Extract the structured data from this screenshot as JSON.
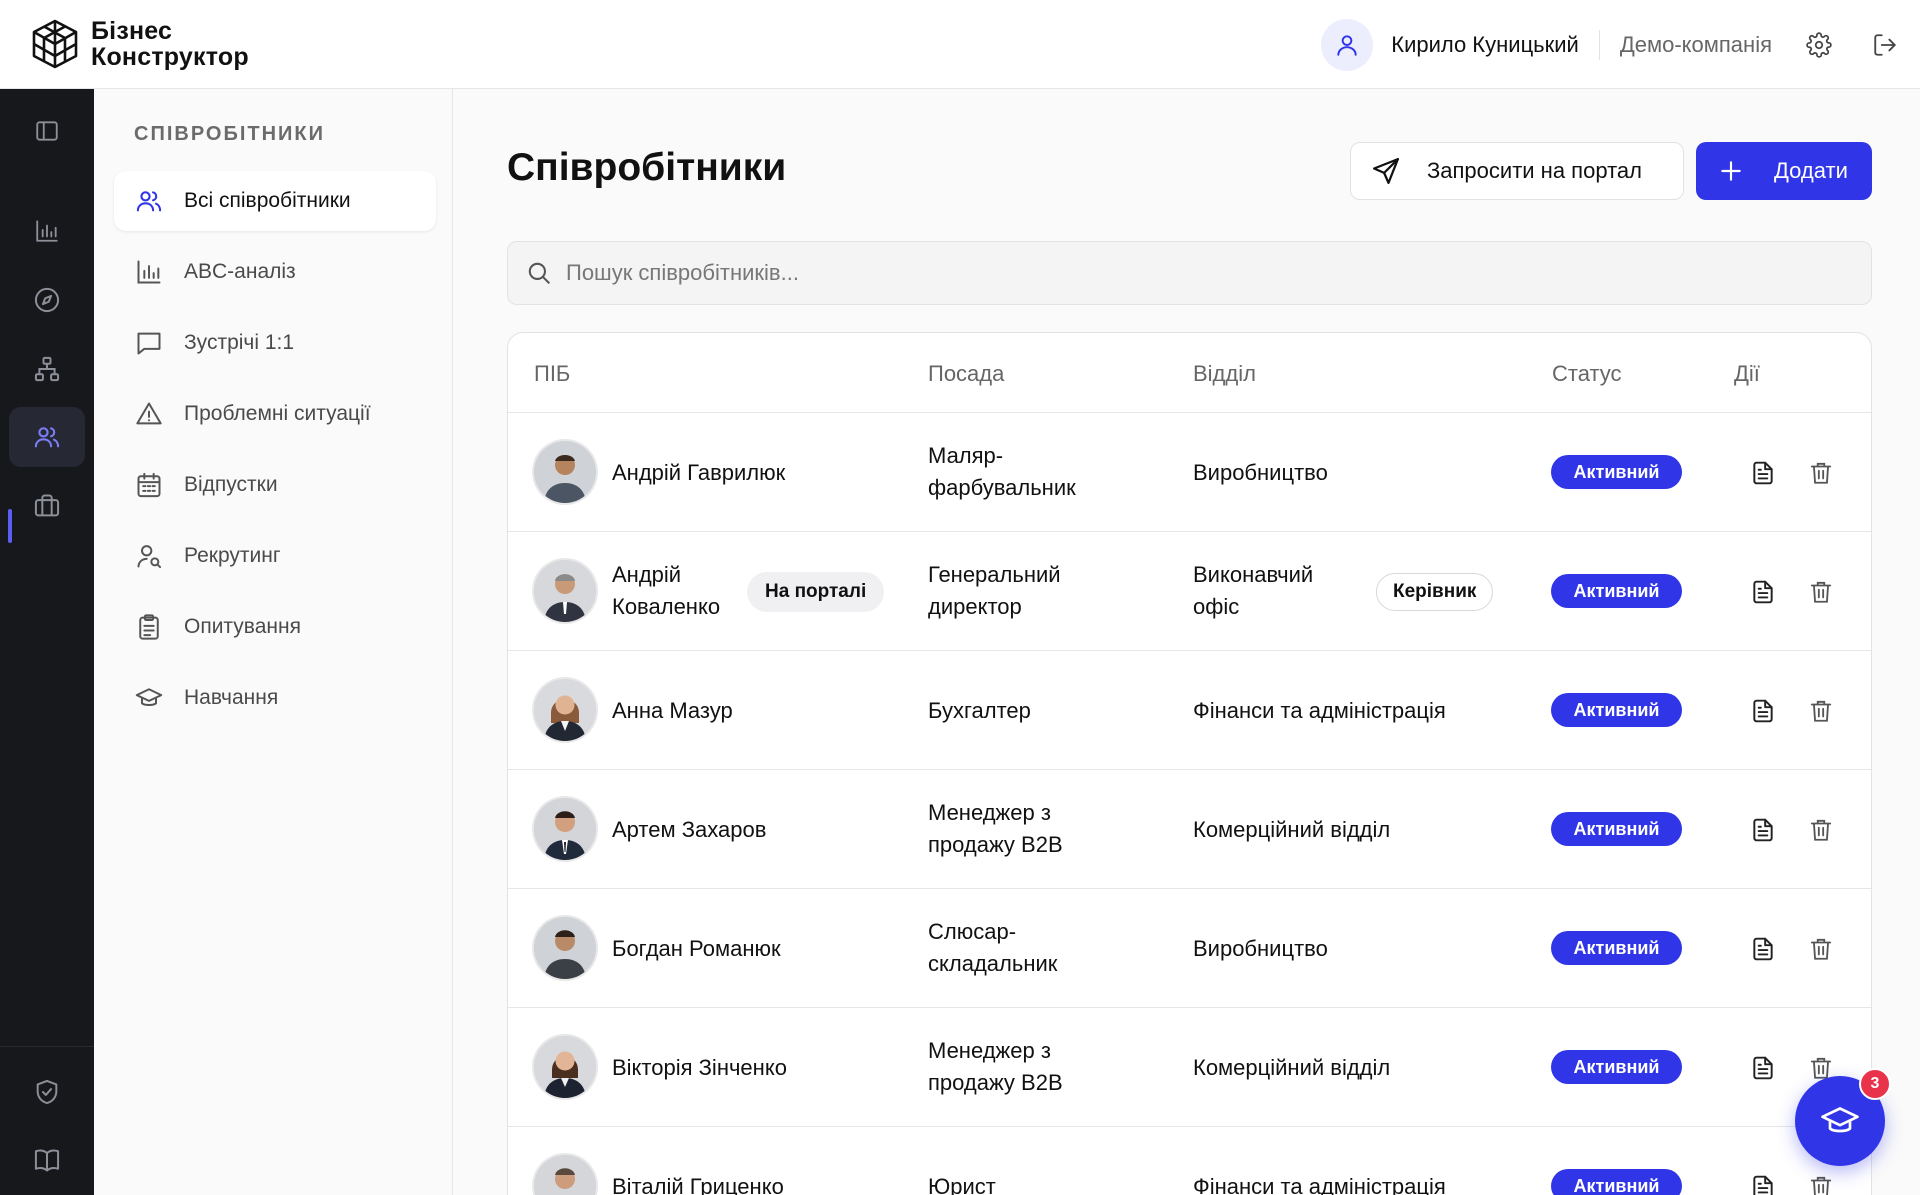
{
  "header": {
    "brand_line1": "Бізнес",
    "brand_line2": "Конструктор",
    "user_name": "Кирило Куницький",
    "company": "Демо-компанія"
  },
  "rail": {
    "icons": [
      "sidebar-toggle-icon",
      "bar-chart-icon",
      "compass-icon",
      "org-structure-icon",
      "users-icon",
      "briefcase-icon",
      "shield-check-icon",
      "book-icon"
    ],
    "active": "users-icon"
  },
  "subnav": {
    "title": "СПІВРОБІТНИКИ",
    "items": [
      {
        "label": "Всі співробітники",
        "icon": "users-icon"
      },
      {
        "label": "ABC-аналіз",
        "icon": "bar-chart-icon"
      },
      {
        "label": "Зустрічі 1:1",
        "icon": "message-icon"
      },
      {
        "label": "Проблемні ситуації",
        "icon": "warning-icon"
      },
      {
        "label": "Відпустки",
        "icon": "calendar-icon"
      },
      {
        "label": "Рекрутинг",
        "icon": "user-search-icon"
      },
      {
        "label": "Опитування",
        "icon": "clipboard-icon"
      },
      {
        "label": "Навчання",
        "icon": "graduation-cap-icon"
      }
    ]
  },
  "main": {
    "title": "Співробітники",
    "invite_label": "Запросити на портал",
    "add_label": "Додати",
    "search_placeholder": "Пошук співробітників..."
  },
  "table": {
    "columns": [
      "ПІБ",
      "Посада",
      "Відділ",
      "Статус",
      "Дії"
    ],
    "rows": [
      {
        "name": [
          "Андрій Гаврилюк"
        ],
        "position": [
          "Маляр-",
          "фарбувальник"
        ],
        "dept": [
          "Виробництво"
        ],
        "status": "Активний"
      },
      {
        "name": [
          "Андрій",
          "Коваленко"
        ],
        "name_tag": "На порталі",
        "position": [
          "Генеральний",
          "директор"
        ],
        "dept": [
          "Виконавчий",
          "офіс"
        ],
        "dept_tag": "Керівник",
        "status": "Активний"
      },
      {
        "name": [
          "Анна Мазур"
        ],
        "position": [
          "Бухгалтер"
        ],
        "dept": [
          "Фінанси та адміністрація"
        ],
        "status": "Активний"
      },
      {
        "name": [
          "Артем Захаров"
        ],
        "position": [
          "Менеджер з",
          "продажу B2B"
        ],
        "dept": [
          "Комерційний відділ"
        ],
        "status": "Активний"
      },
      {
        "name": [
          "Богдан Романюк"
        ],
        "position": [
          "Слюсар-",
          "складальник"
        ],
        "dept": [
          "Виробництво"
        ],
        "status": "Активний"
      },
      {
        "name": [
          "Вікторія Зінченко"
        ],
        "position": [
          "Менеджер з",
          "продажу B2B"
        ],
        "dept": [
          "Комерційний відділ"
        ],
        "status": "Активний"
      },
      {
        "name": [
          "Віталій Гриценко"
        ],
        "position": [
          "Юрист"
        ],
        "dept": [
          "Фінанси та адміністрація"
        ],
        "status": "Активний"
      }
    ]
  },
  "help": {
    "badge_count": "3",
    "icon": "graduation-cap-icon"
  },
  "colors": {
    "accent": "#3035e8",
    "rail_bg": "#17181c",
    "badge": "#e8334a"
  }
}
